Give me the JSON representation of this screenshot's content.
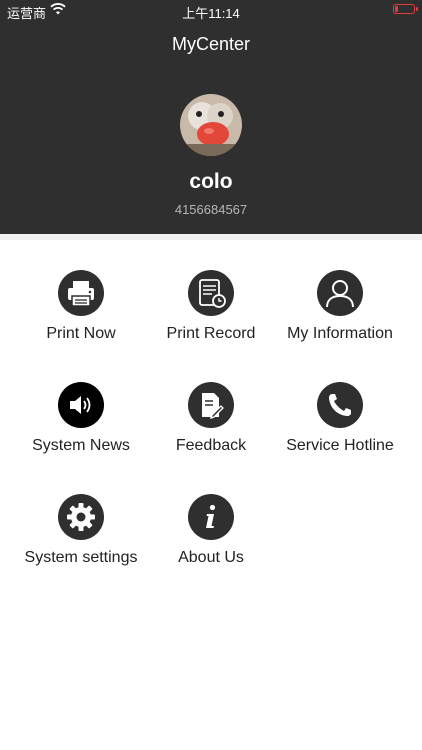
{
  "status": {
    "carrier": "运营商",
    "time": "上午11:14"
  },
  "header": {
    "title": "MyCenter"
  },
  "profile": {
    "username": "colo",
    "phone": "4156684567"
  },
  "menu": [
    {
      "label": "Print Now",
      "icon": "printer-icon"
    },
    {
      "label": "Print Record",
      "icon": "document-clock-icon"
    },
    {
      "label": "My Information",
      "icon": "person-icon"
    },
    {
      "label": "System News",
      "icon": "speaker-icon"
    },
    {
      "label": "Feedback",
      "icon": "edit-document-icon"
    },
    {
      "label": "Service Hotline",
      "icon": "phone-icon"
    },
    {
      "label": "System settings",
      "icon": "gear-icon"
    },
    {
      "label": "About Us",
      "icon": "info-icon"
    }
  ],
  "colors": {
    "header_bg": "#2f2f2f",
    "icon_bg": "#2f2f2f",
    "battery": "#e23b3b"
  }
}
